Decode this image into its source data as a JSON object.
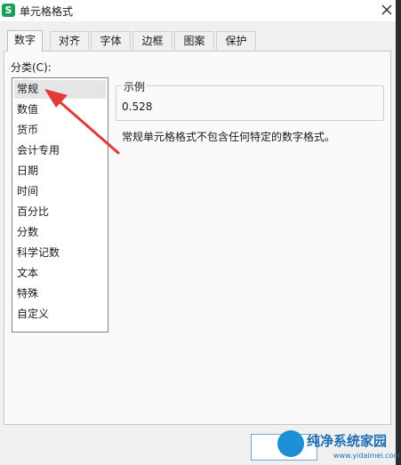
{
  "window": {
    "title": "单元格格式",
    "app_icon_letter": "S"
  },
  "tabs": [
    {
      "label": "数字",
      "active": true
    },
    {
      "label": "对齐"
    },
    {
      "label": "字体"
    },
    {
      "label": "边框"
    },
    {
      "label": "图案"
    },
    {
      "label": "保护"
    }
  ],
  "category": {
    "label": "分类(C):",
    "items": [
      "常规",
      "数值",
      "货币",
      "会计专用",
      "日期",
      "时间",
      "百分比",
      "分数",
      "科学记数",
      "文本",
      "特殊",
      "自定义"
    ],
    "selected": "常规"
  },
  "sample": {
    "label": "示例",
    "value": "0.528"
  },
  "description": "常规单元格格式不包含任何特定的数字格式。",
  "watermark": {
    "text": "纯净系统家园",
    "url": "www.yidaimei.com"
  },
  "colors": {
    "annotation_arrow": "#e53935",
    "app_icon": "#19a05a",
    "watermark": "#1c6fb5"
  }
}
